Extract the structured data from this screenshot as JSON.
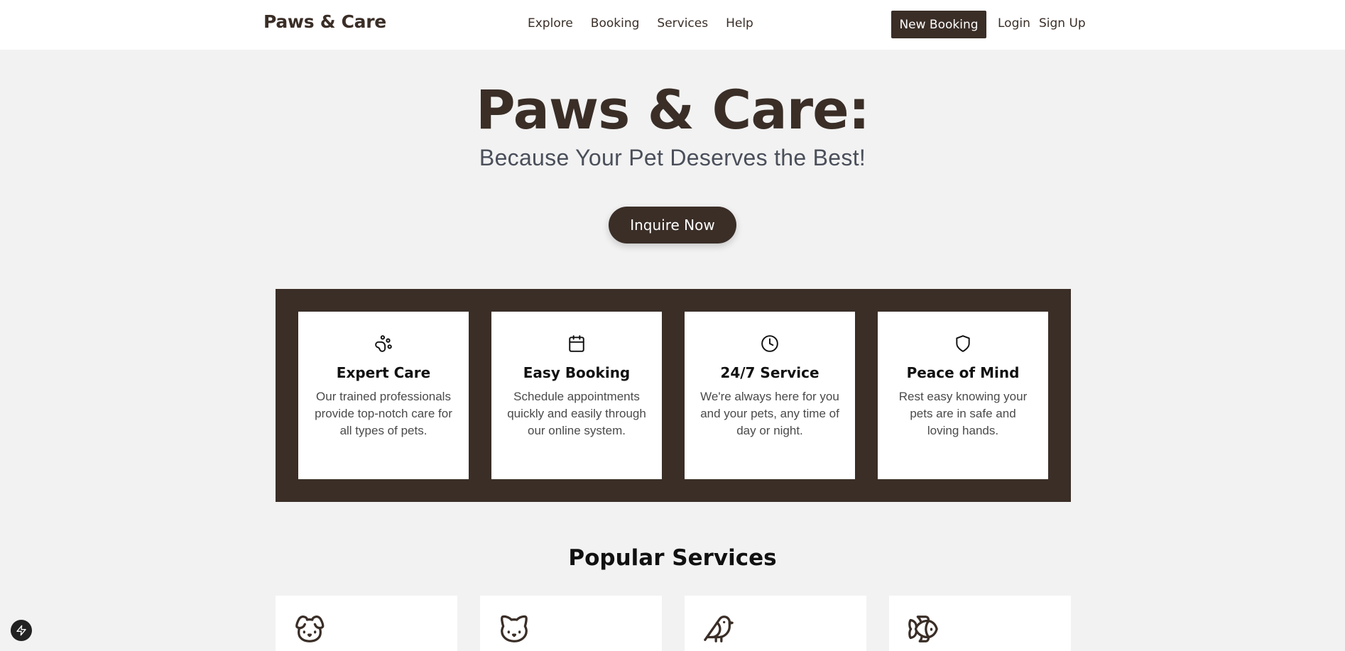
{
  "nav": {
    "brand": "Paws & Care",
    "links": [
      "Explore",
      "Booking",
      "Services",
      "Help"
    ],
    "new_booking": "New Booking",
    "login": "Login",
    "signup": "Sign Up"
  },
  "hero": {
    "title": "Paws & Care:",
    "subtitle": "Because Your Pet Deserves the Best!",
    "cta": "Inquire Now"
  },
  "features": [
    {
      "icon": "paw-icon",
      "title": "Expert Care",
      "desc": "Our trained professionals provide top-notch care for all types of pets."
    },
    {
      "icon": "calendar-icon",
      "title": "Easy Booking",
      "desc": "Schedule appointments quickly and easily through our online system."
    },
    {
      "icon": "clock-icon",
      "title": "24/7 Service",
      "desc": "We're always here for you and your pets, any time of day or night."
    },
    {
      "icon": "shield-icon",
      "title": "Peace of Mind",
      "desc": "Rest easy knowing your pets are in safe and loving hands."
    }
  ],
  "popular": {
    "title": "Popular Services",
    "icons": [
      "dog-icon",
      "cat-icon",
      "bird-icon",
      "fish-icon"
    ]
  },
  "colors": {
    "brand_dark": "#3a2e27",
    "background": "#f2f2f2",
    "card": "#ffffff"
  }
}
